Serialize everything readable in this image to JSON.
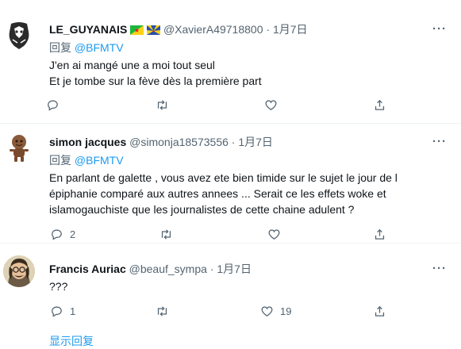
{
  "tweets": [
    {
      "name": "LE_GUYANAIS",
      "handle": "@XavierA49718800",
      "dot": "·",
      "date": "1月7日",
      "reply_prefix": "回复",
      "reply_to": "@BFMTV",
      "lines": [
        "J'en ai mangé une a moi tout seul",
        "Et je tombe sur la fève dès la première part"
      ],
      "reply_count": "",
      "like_count": ""
    },
    {
      "name": "simon jacques",
      "handle": "@simonja18573556",
      "dot": "·",
      "date": "1月7日",
      "reply_prefix": "回复",
      "reply_to": "@BFMTV",
      "lines": [
        "En parlant de galette , vous avez ete bien timide sur le sujet le jour de l",
        "épiphanie comparé aux autres annees ... Serait ce les effets woke et",
        "islamogauchiste que les journalistes de cette chaine adulent ?"
      ],
      "reply_count": "2",
      "like_count": ""
    },
    {
      "name": "Francis Auriac",
      "handle": "@beauf_sympa",
      "dot": "·",
      "date": "1月7日",
      "lines": [
        "???"
      ],
      "reply_count": "1",
      "like_count": "19"
    }
  ],
  "more_label": "···",
  "show_replies": "显示回复",
  "colors": {
    "accent": "#1d9bf0",
    "muted": "#536471",
    "text": "#0f1419",
    "divider": "#eff3f4"
  },
  "icons": [
    "reply-icon",
    "retweet-icon",
    "like-icon",
    "share-icon",
    "more-icon"
  ]
}
